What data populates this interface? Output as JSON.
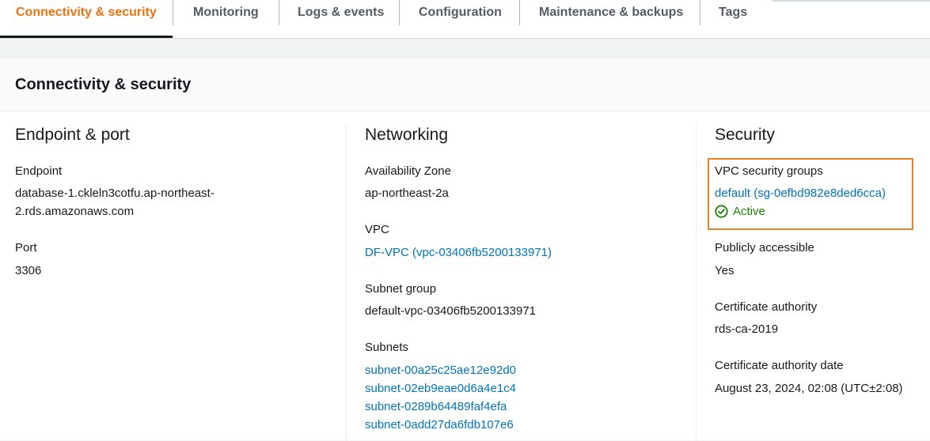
{
  "tabs": [
    {
      "label": "Connectivity & security",
      "active": true
    },
    {
      "label": "Monitoring"
    },
    {
      "label": "Logs & events"
    },
    {
      "label": "Configuration"
    },
    {
      "label": "Maintenance & backups"
    },
    {
      "label": "Tags"
    }
  ],
  "panel": {
    "title": "Connectivity & security"
  },
  "endpoint_section": {
    "title": "Endpoint & port",
    "endpoint_label": "Endpoint",
    "endpoint_value_line1": "database-1.ckleln3cotfu.ap-northeast-",
    "endpoint_value_line2": "2.rds.amazonaws.com",
    "port_label": "Port",
    "port_value": "3306"
  },
  "networking_section": {
    "title": "Networking",
    "az_label": "Availability Zone",
    "az_value": "ap-northeast-2a",
    "vpc_label": "VPC",
    "vpc_value": "DF-VPC (vpc-03406fb5200133971)",
    "subnet_group_label": "Subnet group",
    "subnet_group_value": "default-vpc-03406fb5200133971",
    "subnets_label": "Subnets",
    "subnets": [
      "subnet-00a25c25ae12e92d0",
      "subnet-02eb9eae0d6a4e1c4",
      "subnet-0289b64489faf4efa",
      "subnet-0add27da6fdb107e6"
    ]
  },
  "security_section": {
    "title": "Security",
    "sg_label": "VPC security groups",
    "sg_value": "default (sg-0efbd982e8ded6cca)",
    "sg_status": "Active",
    "sg_status_icon": "check-circle-icon",
    "public_label": "Publicly accessible",
    "public_value": "Yes",
    "ca_label": "Certificate authority",
    "ca_value": "rds-ca-2019",
    "ca_date_label": "Certificate authority date",
    "ca_date_value": "August 23, 2024, 02:08 (UTC±2:08)"
  },
  "colors": {
    "accent": "#ec7211",
    "link": "#0073bb",
    "success": "#1d8102",
    "highlight": "#e8832a"
  }
}
